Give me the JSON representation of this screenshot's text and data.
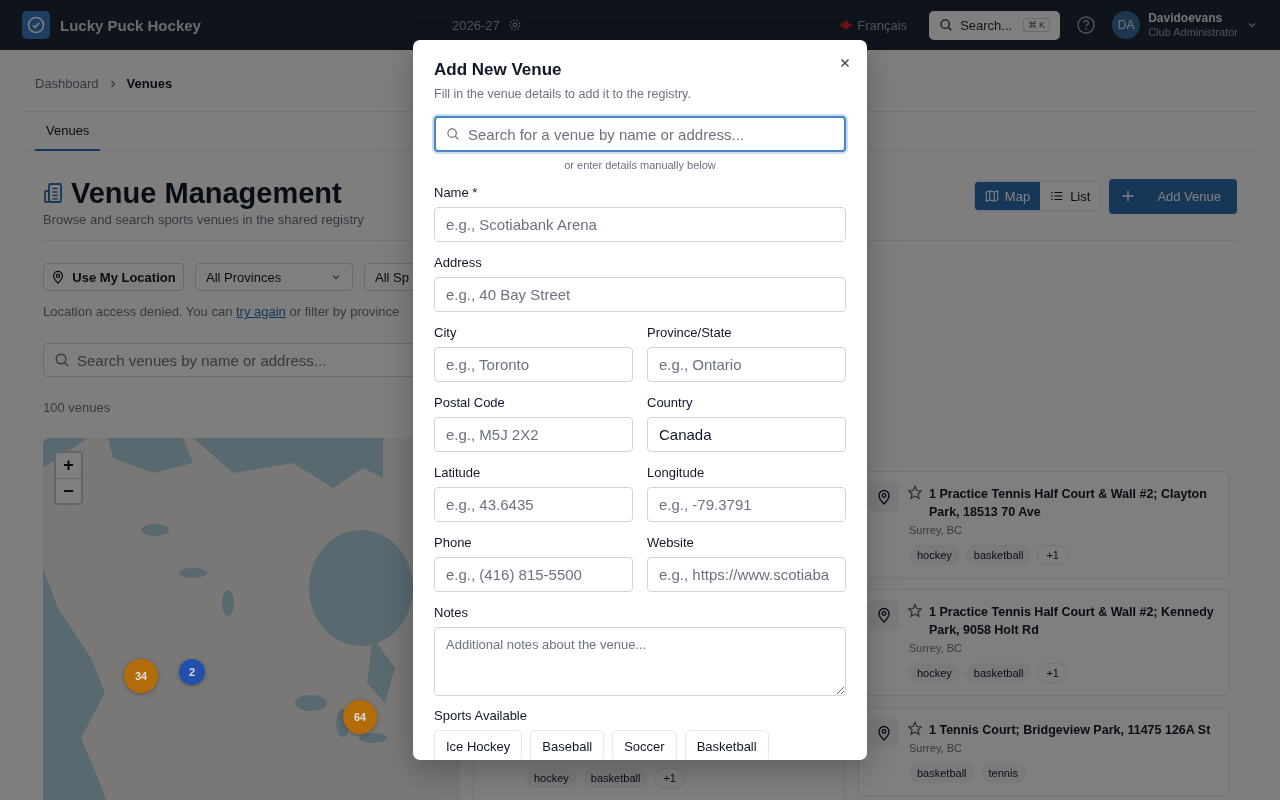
{
  "topbar": {
    "app_name": "Lucky Puck Hockey",
    "season": "2026-27",
    "language": "Français",
    "search": {
      "label": "Search...",
      "shortcut": "⌘ K"
    },
    "user": {
      "initials": "DA",
      "name": "Davidoevans",
      "role": "Club Administrator"
    }
  },
  "breadcrumb": [
    {
      "label": "Dashboard",
      "current": false
    },
    {
      "label": "Venues",
      "current": true
    }
  ],
  "tabs": [
    {
      "label": "Venues",
      "selected": true
    }
  ],
  "header": {
    "title": "Venue Management",
    "subtitle": "Browse and search sports venues in the shared registry"
  },
  "view_toggle": [
    {
      "label": "Map",
      "selected": true
    },
    {
      "label": "List",
      "selected": false
    }
  ],
  "add_button": "Add Venue",
  "filters": {
    "location_button": "Use My Location",
    "province": "All Provinces",
    "sport": "All Sp"
  },
  "location_message": {
    "before": "Location access denied. You can ",
    "link": "try again",
    "after": " or filter by province"
  },
  "search": {
    "placeholder": "Search venues by name or address..."
  },
  "count": "100 venues",
  "map": {
    "zoom_in": "+",
    "zoom_out": "−",
    "clusters": [
      {
        "count": "34",
        "color": "#b36c0a"
      },
      {
        "count": "2",
        "color": "#2450ad"
      },
      {
        "count": "64",
        "color": "#b36c0a"
      }
    ]
  },
  "partial_card": {
    "tags": [
      "hockey",
      "basketball"
    ],
    "more": "+1"
  },
  "venues": [
    {
      "title": "1 Practice Tennis Half Court & Wall #2; Clayton Park, 18513 70 Ave",
      "location": "Surrey, BC",
      "favorite": false,
      "tags": [
        "hockey",
        "basketball"
      ],
      "more": "+1"
    },
    {
      "title": "1 Practice Tennis Half Court & Wall #2; Kennedy Park, 9058 Holt Rd",
      "location": "Surrey, BC",
      "favorite": false,
      "tags": [
        "hockey",
        "basketball"
      ],
      "more": "+1"
    },
    {
      "title": "1 Tennis Court; Bridgeview Park, 11475 126A St",
      "location": "Surrey, BC",
      "favorite": false,
      "tags": [
        "basketball",
        "tennis"
      ]
    }
  ],
  "modal": {
    "title": "Add New Venue",
    "subtitle": "Fill in the venue details to add it to the registry.",
    "search": {
      "placeholder": "Search for a venue by name or address...",
      "focused": true
    },
    "hint": "or enter details manually below",
    "rows": [
      [
        {
          "label": "Name *",
          "placeholder": "e.g., Scotiabank Arena",
          "kind": "input"
        }
      ],
      [
        {
          "label": "Address",
          "placeholder": "e.g., 40 Bay Street",
          "kind": "input"
        }
      ],
      [
        {
          "label": "City",
          "placeholder": "e.g., Toronto",
          "kind": "input"
        },
        {
          "label": "Province/State",
          "placeholder": "e.g., Ontario",
          "kind": "input"
        }
      ],
      [
        {
          "label": "Postal Code",
          "placeholder": "e.g., M5J 2X2",
          "kind": "input"
        },
        {
          "label": "Country",
          "value": "Canada",
          "kind": "input"
        }
      ],
      [
        {
          "label": "Latitude",
          "placeholder": "e.g., 43.6435",
          "kind": "input"
        },
        {
          "label": "Longitude",
          "placeholder": "e.g., -79.3791",
          "kind": "input"
        }
      ],
      [
        {
          "label": "Phone",
          "placeholder": "e.g., (416) 815-5500",
          "kind": "input"
        },
        {
          "label": "Website",
          "placeholder": "e.g., https://www.scotiaba",
          "kind": "input"
        }
      ],
      [
        {
          "label": "Notes",
          "placeholder": "Additional notes about the venue...",
          "kind": "textarea"
        }
      ]
    ],
    "sports_label": "Sports Available",
    "sports": [
      {
        "label": "Ice Hockey",
        "selected": false
      },
      {
        "label": "Baseball",
        "selected": false
      },
      {
        "label": "Soccer",
        "selected": false
      },
      {
        "label": "Basketball",
        "selected": false
      }
    ]
  }
}
